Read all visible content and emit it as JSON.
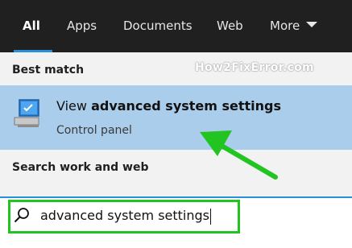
{
  "tabs": [
    {
      "label": "All",
      "active": true
    },
    {
      "label": "Apps"
    },
    {
      "label": "Documents"
    },
    {
      "label": "Web"
    },
    {
      "label": "More"
    }
  ],
  "sections": {
    "best_match": "Best match",
    "search_work_web": "Search work and web"
  },
  "watermark": "How2FixError.com",
  "best_result": {
    "title_prefix": "View ",
    "title_bold": "advanced system settings",
    "subtitle": "Control panel",
    "icon": "computer-icon"
  },
  "search": {
    "value": "advanced system settings",
    "icon": "search-icon"
  },
  "colors": {
    "accent": "#2a8fdb",
    "highlight_row": "#a9cdea",
    "annotation_green": "#22c422"
  }
}
